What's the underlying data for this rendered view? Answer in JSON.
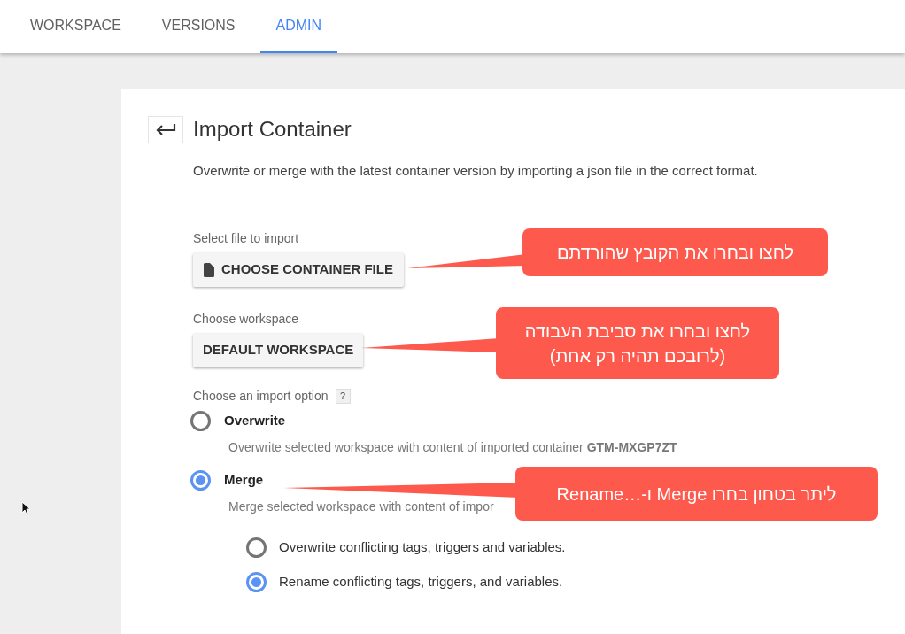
{
  "tabs": [
    {
      "label": "WORKSPACE",
      "selected": false
    },
    {
      "label": "VERSIONS",
      "selected": false
    },
    {
      "label": "ADMIN",
      "selected": true
    }
  ],
  "page": {
    "title": "Import Container",
    "description": "Overwrite or merge with the latest container version by importing a json file in the correct format.",
    "file_section": {
      "label": "Select file to import",
      "button": "CHOOSE CONTAINER FILE"
    },
    "workspace_section": {
      "label": "Choose workspace",
      "button": "DEFAULT WORKSPACE"
    },
    "import_option": {
      "label": "Choose an import option",
      "help": "?",
      "options": [
        {
          "label": "Overwrite",
          "description": "Overwrite selected workspace with content of imported container **GTM-MXGP7ZT**",
          "selected": false
        },
        {
          "label": "Merge",
          "description": "Merge selected workspace with content of impor",
          "selected": true,
          "children": [
            {
              "label": "Overwrite conflicting tags, triggers and variables.",
              "selected": false
            },
            {
              "label": "Rename conflicting tags, triggers, and variables.",
              "selected": true
            }
          ]
        }
      ]
    }
  },
  "annotations": [
    {
      "lines": [
        "לחצו ובחרו את הקובץ שהורדתם"
      ]
    },
    {
      "lines": [
        "לחצו ובחרו את סביבת העבודה",
        "(לרובכם תהיה רק אחת)"
      ]
    },
    {
      "lines": [
        "ליתר בטחון בחרו Merge ו-…Rename"
      ]
    }
  ]
}
